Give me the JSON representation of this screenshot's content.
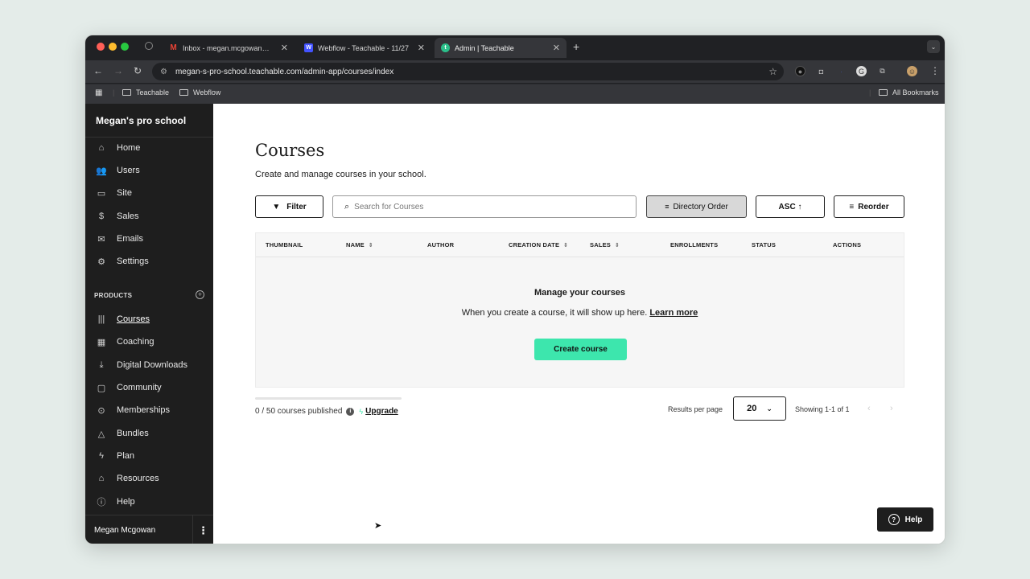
{
  "browser": {
    "tabs": [
      {
        "title": "Inbox - megan.mcgowan@te",
        "favicon": "gmail-icon"
      },
      {
        "title": "Webflow - Teachable - 11/27",
        "favicon": "webflow-icon"
      },
      {
        "title": "Admin | Teachable",
        "favicon": "teachable-icon",
        "active": true
      }
    ],
    "url": "megan-s-pro-school.teachable.com/admin-app/courses/index",
    "bookmarks": [
      "Teachable",
      "Webflow"
    ],
    "all_bookmarks": "All Bookmarks"
  },
  "sidebar": {
    "school_name": "Megan's pro school",
    "nav": [
      {
        "label": "Home",
        "icon": "home-icon"
      },
      {
        "label": "Users",
        "icon": "users-icon"
      },
      {
        "label": "Site",
        "icon": "site-icon"
      },
      {
        "label": "Sales",
        "icon": "dollar-icon"
      },
      {
        "label": "Emails",
        "icon": "mail-icon"
      },
      {
        "label": "Settings",
        "icon": "gear-icon"
      }
    ],
    "products_heading": "PRODUCTS",
    "products": [
      {
        "label": "Courses",
        "icon": "library-icon",
        "active": true
      },
      {
        "label": "Coaching",
        "icon": "calendar-icon"
      },
      {
        "label": "Digital Downloads",
        "icon": "download-icon"
      },
      {
        "label": "Community",
        "icon": "chat-icon"
      },
      {
        "label": "Memberships",
        "icon": "membership-icon"
      },
      {
        "label": "Bundles",
        "icon": "shapes-icon"
      },
      {
        "label": "Plan",
        "icon": "bolt-icon"
      },
      {
        "label": "Resources",
        "icon": "graduation-icon"
      },
      {
        "label": "Help",
        "icon": "help-icon"
      }
    ],
    "user_name": "Megan Mcgowan"
  },
  "main": {
    "title": "Courses",
    "subtitle": "Create and manage courses in your school.",
    "filter_label": "Filter",
    "search_placeholder": "Search for Courses",
    "sort_label": "Directory Order",
    "order_label": "ASC ↑",
    "reorder_label": "Reorder",
    "columns": [
      "THUMBNAIL",
      "NAME",
      "AUTHOR",
      "CREATION DATE",
      "SALES",
      "ENROLLMENTS",
      "STATUS",
      "ACTIONS"
    ],
    "empty_title": "Manage your courses",
    "empty_desc": "When you create a course, it will show up here.",
    "learn_more": "Learn more",
    "create_label": "Create course",
    "published_text": "0 / 50 courses published",
    "published_fraction": 0,
    "upgrade_label": "Upgrade",
    "results_per_page_label": "Results per page",
    "results_per_page": "20",
    "showing_text": "Showing 1-1 of 1",
    "help_label": "Help"
  },
  "colors": {
    "accent": "#3de6ad",
    "sidebar_bg": "#1e1e1e",
    "chrome_bg": "#202124"
  }
}
